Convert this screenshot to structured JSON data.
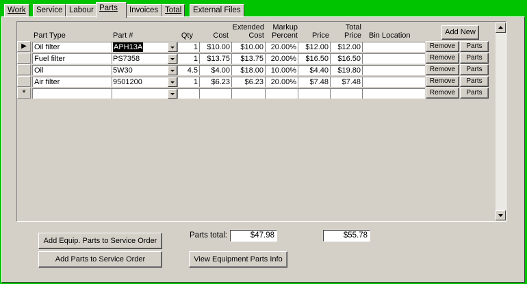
{
  "tabs": [
    {
      "label": "Work"
    },
    {
      "label": "Service"
    },
    {
      "label": "Labour"
    },
    {
      "label": "Parts"
    },
    {
      "label": "Invoices"
    },
    {
      "label": "Total"
    },
    {
      "label": "External Files"
    }
  ],
  "active_tab": "Parts",
  "grid": {
    "headers": {
      "part_type": "Part Type",
      "part_no": "Part #",
      "qty": "Qty",
      "cost": "Cost",
      "extended_cost_1": "Extended",
      "extended_cost_2": "Cost",
      "markup_1": "Markup",
      "markup_2": "Percent",
      "price": "Price",
      "total_price_1": "Total",
      "total_price_2": "Price",
      "bin_location": "Bin Location"
    },
    "add_new_label": "Add New",
    "remove_label": "Remove",
    "parts_label": "Parts",
    "rows": [
      {
        "part_type": "Oil filter",
        "part_no": "APH13A",
        "qty": "1",
        "cost": "$10.00",
        "extended_cost": "$10.00",
        "markup": "20.00%",
        "price": "$12.00",
        "total_price": "$12.00",
        "bin_location": ""
      },
      {
        "part_type": "Fuel filter",
        "part_no": "PS7358",
        "qty": "1",
        "cost": "$13.75",
        "extended_cost": "$13.75",
        "markup": "20.00%",
        "price": "$16.50",
        "total_price": "$16.50",
        "bin_location": ""
      },
      {
        "part_type": "Oil",
        "part_no": "5W30",
        "qty": "4.5",
        "cost": "$4.00",
        "extended_cost": "$18.00",
        "markup": "10.00%",
        "price": "$4.40",
        "total_price": "$19.80",
        "bin_location": ""
      },
      {
        "part_type": "Air filter",
        "part_no": "9501200",
        "qty": "1",
        "cost": "$6.23",
        "extended_cost": "$6.23",
        "markup": "20.00%",
        "price": "$7.48",
        "total_price": "$7.48",
        "bin_location": ""
      }
    ],
    "current_row_marker": "▶",
    "new_row_marker": "*"
  },
  "footer": {
    "add_equip_parts_label": "Add Equip. Parts to Service Order",
    "add_parts_label": "Add Parts to Service Order",
    "parts_total_label": "Parts total:",
    "parts_total_cost": "$47.98",
    "parts_total_price": "$55.78",
    "view_equipment_parts_label": "View Equipment Parts Info"
  },
  "colors": {
    "background": "#00c400",
    "dialog": "#d4d0c8"
  }
}
